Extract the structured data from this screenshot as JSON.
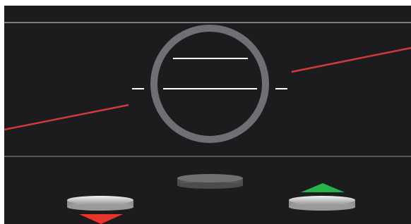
{
  "panel": {
    "background_color": "#1c1c1e",
    "divider_color": "#9a9a9c",
    "horizon_line_color": "#d13a3a",
    "gauge_ring_color": "#6e7073",
    "gauge_bar_color": "#ffffff"
  },
  "controls": {
    "decrease_arrow_color": "#e8352b",
    "increase_arrow_color": "#27b34a",
    "center_disc_color": "#6a6c6e",
    "side_disc_color": "#e2e2e2"
  },
  "icons": {
    "down_arrow": "triangle-down",
    "up_arrow": "triangle-up",
    "discs": "ellipse-buttons"
  }
}
